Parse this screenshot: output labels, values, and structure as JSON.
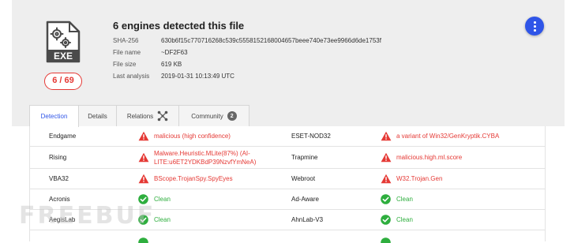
{
  "file": {
    "title": "6 engines detected this file",
    "score": "6 / 69",
    "icon_label": "EXE",
    "meta": [
      {
        "label": "SHA-256",
        "value": "630b6f15c770716268c539c5558152168004657beee740e73ee9966d6de1753f"
      },
      {
        "label": "File name",
        "value": "~DF2F63"
      },
      {
        "label": "File size",
        "value": "619 KB"
      },
      {
        "label": "Last analysis",
        "value": "2019-01-31 10:13:49 UTC"
      }
    ]
  },
  "tabs": [
    {
      "label": "Detection",
      "active": true
    },
    {
      "label": "Details",
      "active": false
    },
    {
      "label": "Relations",
      "active": false,
      "icon": "relations-graph-icon"
    },
    {
      "label": "Community",
      "active": false,
      "count": "2"
    }
  ],
  "results": [
    {
      "left": {
        "engine": "Endgame",
        "status": "malicious",
        "result": "malicious (high confidence)"
      },
      "right": {
        "engine": "ESET-NOD32",
        "status": "malicious",
        "result": "a variant of Win32/GenKryptik.CYBA"
      }
    },
    {
      "left": {
        "engine": "Rising",
        "status": "malicious",
        "result": "Malware.Heuristic.MLite(87%) (AI-LITE:u6ET2YDKBdP39NzvfYmNeA)"
      },
      "right": {
        "engine": "Trapmine",
        "status": "malicious",
        "result": "malicious.high.ml.score"
      }
    },
    {
      "left": {
        "engine": "VBA32",
        "status": "malicious",
        "result": "BScope.TrojanSpy.SpyEyes"
      },
      "right": {
        "engine": "Webroot",
        "status": "malicious",
        "result": "W32.Trojan.Gen"
      }
    },
    {
      "left": {
        "engine": "Acronis",
        "status": "clean",
        "result": "Clean"
      },
      "right": {
        "engine": "Ad-Aware",
        "status": "clean",
        "result": "Clean"
      }
    },
    {
      "left": {
        "engine": "AegisLab",
        "status": "clean",
        "result": "Clean"
      },
      "right": {
        "engine": "AhnLab-V3",
        "status": "clean",
        "result": "Clean"
      }
    }
  ],
  "watermark": "FREEBUF",
  "colors": {
    "malicious": "#e53935",
    "clean": "#2eae3e",
    "accent": "#2f55e8"
  }
}
